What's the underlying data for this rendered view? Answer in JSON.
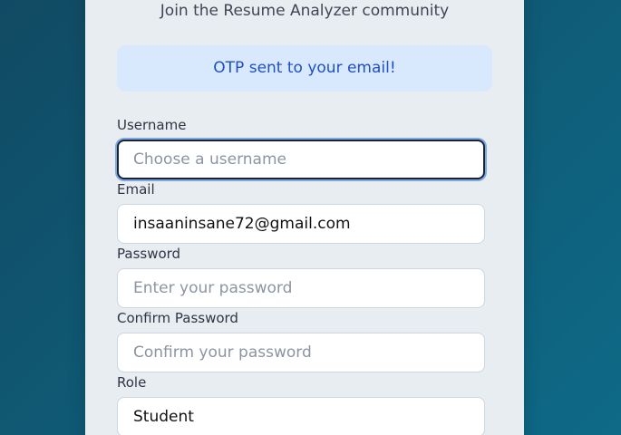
{
  "card": {
    "subtitle": "Join the Resume Analyzer community"
  },
  "alert": {
    "message": "OTP sent to your email!"
  },
  "fields": {
    "username": {
      "label": "Username",
      "placeholder": "Choose a username",
      "value": ""
    },
    "email": {
      "label": "Email",
      "value": "insaaninsane72@gmail.com"
    },
    "password": {
      "label": "Password",
      "placeholder": "Enter your password",
      "value": ""
    },
    "confirm_password": {
      "label": "Confirm Password",
      "placeholder": "Confirm your password",
      "value": ""
    },
    "role": {
      "label": "Role",
      "selected": "Student"
    }
  },
  "colors": {
    "background_start": "#114a63",
    "background_end": "#0e6a87",
    "card": "#e8edf2",
    "alert_bg": "#d9e9fd",
    "alert_text": "#1f4fc4",
    "focus_ring": "#7ea9e7"
  }
}
